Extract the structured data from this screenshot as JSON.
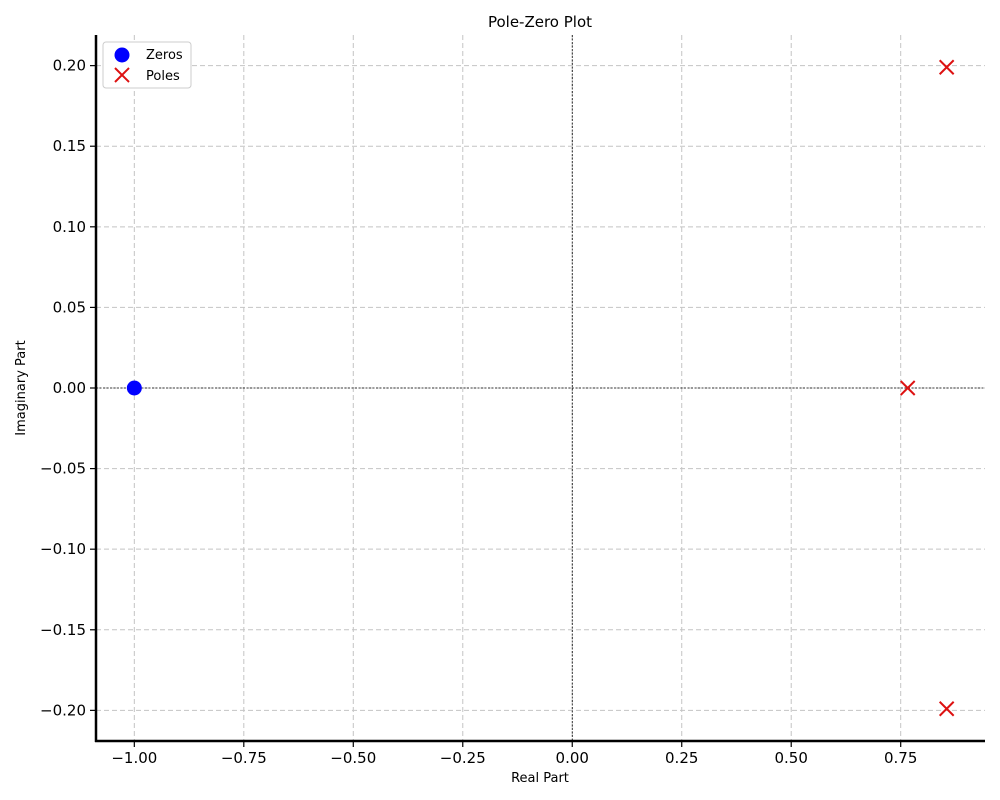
{
  "chart_data": {
    "type": "scatter",
    "title": "Pole-Zero Plot",
    "xlabel": "Real Part",
    "ylabel": "Imaginary Part",
    "xlim": [
      -1.0875,
      0.9425
    ],
    "ylim": [
      -0.219,
      0.219
    ],
    "x_ticks": [
      -1.0,
      -0.75,
      -0.5,
      -0.25,
      0.0,
      0.25,
      0.5,
      0.75
    ],
    "x_tick_labels": [
      "−1.00",
      "−0.75",
      "−0.50",
      "−0.25",
      "0.00",
      "0.25",
      "0.50",
      "0.75"
    ],
    "y_ticks": [
      -0.2,
      -0.15,
      -0.1,
      -0.05,
      0.0,
      0.05,
      0.1,
      0.15,
      0.2
    ],
    "y_tick_labels": [
      "−0.20",
      "−0.15",
      "−0.10",
      "−0.05",
      "0.00",
      "0.05",
      "0.10",
      "0.15",
      "0.20"
    ],
    "grid": true,
    "legend_position": "top-left",
    "series": [
      {
        "name": "Zeros",
        "marker": "circle",
        "color": "#0000ff",
        "points": [
          [
            -1.0,
            0.0
          ]
        ]
      },
      {
        "name": "Poles",
        "marker": "x",
        "color": "#dd1111",
        "points": [
          [
            0.855,
            0.199
          ],
          [
            0.766,
            0.0
          ],
          [
            0.855,
            -0.199
          ]
        ]
      }
    ]
  }
}
